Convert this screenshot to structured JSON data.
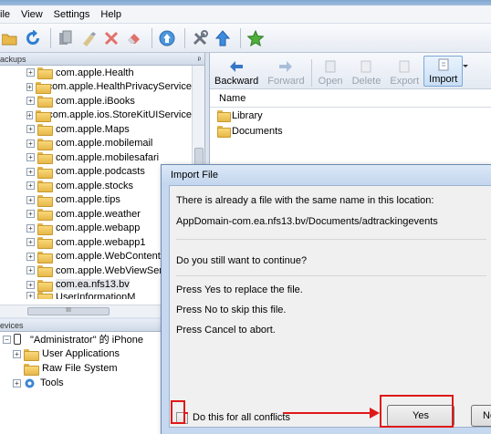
{
  "menu": [
    "ile",
    "View",
    "Settings",
    "Help"
  ],
  "toolbar_icons": [
    "folder-open-icon",
    "refresh-icon",
    "copy-icon",
    "clean-icon",
    "delete-icon",
    "eraser-icon",
    "upload-icon",
    "tools-icon",
    "arrow-up-icon",
    "star-icon"
  ],
  "backups_panel": {
    "header": "ackups",
    "pin": "ᵖ",
    "items": [
      "com.apple.Health",
      "com.apple.HealthPrivacyService",
      "com.apple.iBooks",
      "com.apple.ios.StoreKitUIService",
      "com.apple.Maps",
      "com.apple.mobilemail",
      "com.apple.mobilesafari",
      "com.apple.podcasts",
      "com.apple.stocks",
      "com.apple.tips",
      "com.apple.weather",
      "com.apple.webapp",
      "com.apple.webapp1",
      "com.apple.WebContentFilte",
      "com.apple.WebViewService",
      "com.ea.nfs13.bv"
    ],
    "partial_item": "UserInformationM",
    "hscroll_grip": "III"
  },
  "devices_panel": {
    "header": "evices",
    "device": "\"Administrator\" 的 iPhone",
    "children": [
      "User Applications",
      "Raw File System",
      "Tools"
    ]
  },
  "file_toolbar": {
    "buttons": [
      {
        "label": "Backward",
        "enabled": true
      },
      {
        "label": "Forward",
        "enabled": false
      },
      {
        "label": "Open",
        "enabled": false
      },
      {
        "label": "Delete",
        "enabled": false
      },
      {
        "label": "Export",
        "enabled": false
      },
      {
        "label": "Import",
        "enabled": true
      }
    ]
  },
  "file_list": {
    "column": "Name",
    "rows": [
      "Library",
      "Documents"
    ]
  },
  "dialog": {
    "title": "Import File",
    "line1": "There is already a file with the same name in this location:",
    "path": "AppDomain-com.ea.nfs13.bv/Documents/adtrackingevents",
    "question": "Do you still want to continue?",
    "opt_yes": "Press Yes to replace the file.",
    "opt_no": "Press No to skip this file.",
    "opt_cancel": "Press Cancel to abort.",
    "checkbox_label": "Do this for all conflicts",
    "yes_label": "Yes",
    "no_label": "No"
  },
  "colors": {
    "annotation_red": "#e01818",
    "import_active": "#c9def5"
  }
}
